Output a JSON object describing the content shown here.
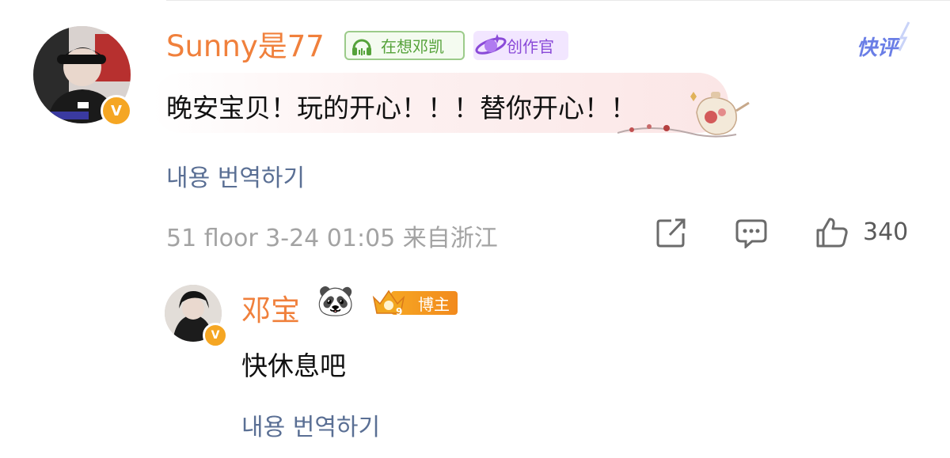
{
  "comment": {
    "username": "Sunny是77",
    "music_badge": "在想邓凯",
    "creator_badge": "创作官",
    "quick_comment": "快评",
    "text": "晚安宝贝！玩的开心！！！替你开心！！",
    "translate": "내용 번역하기",
    "meta": "51 floor 3-24 01:05 来自浙江",
    "like_count": "340",
    "verified_mark": "V"
  },
  "reply": {
    "username": "邓宝",
    "emoji": "🐼",
    "host_badge": "博主",
    "host_level": "9",
    "text": "快休息吧",
    "translate": "내용 번역하기",
    "verified_mark": "V"
  },
  "colors": {
    "username": "#f0803c",
    "translate": "#5a6f94",
    "meta": "#a3a3a3",
    "music_badge": "#55a23a",
    "creator_badge": "#8a4ad8",
    "verified": "#f5a623"
  },
  "icons": [
    "headphone-icon",
    "creator-icon",
    "share-icon",
    "comment-icon",
    "like-icon",
    "crown-icon",
    "teapot-decoration"
  ]
}
